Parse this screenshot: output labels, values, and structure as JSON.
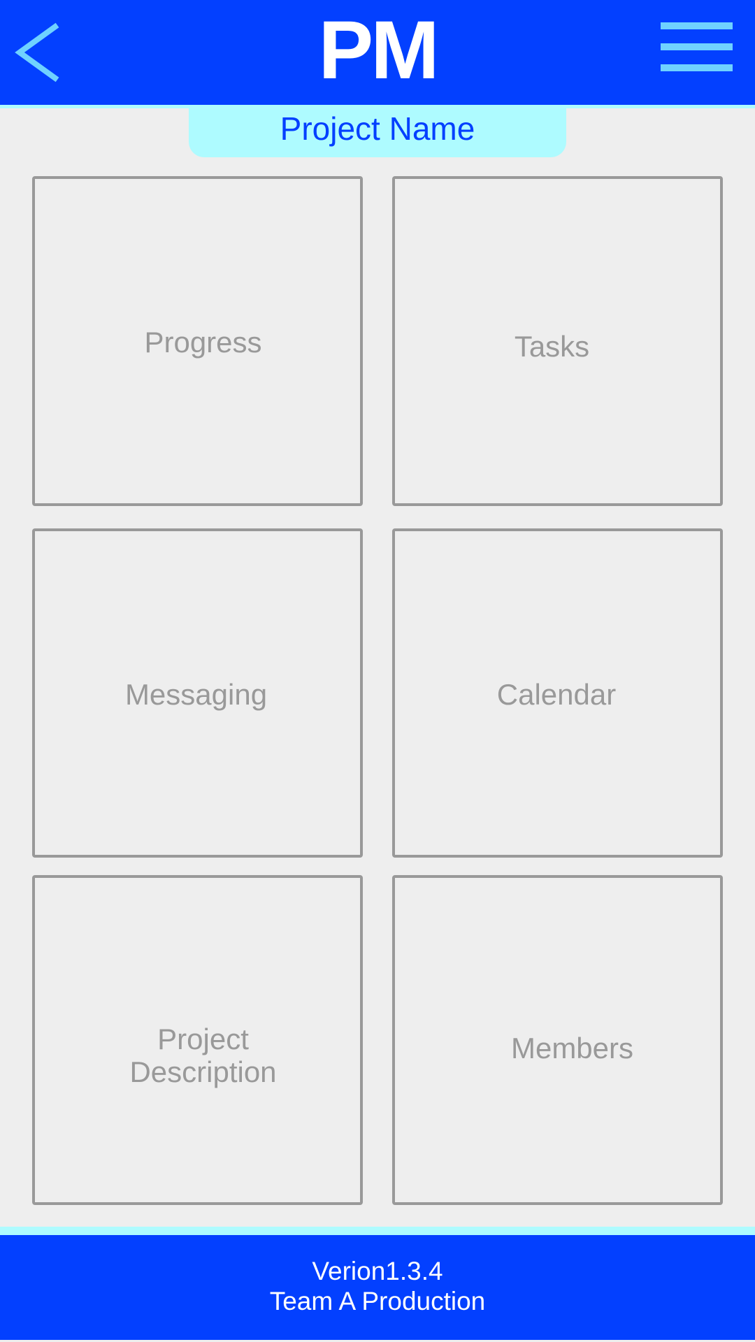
{
  "header": {
    "title": "PM",
    "back_icon": "chevron-left-icon",
    "menu_icon": "hamburger-menu-icon"
  },
  "project": {
    "name": "Project Name"
  },
  "tiles": [
    {
      "label": "Progress"
    },
    {
      "label": "Tasks"
    },
    {
      "label": "Messaging"
    },
    {
      "label": "Calendar"
    },
    {
      "label_line1": "Project",
      "label_line2": "Description"
    },
    {
      "label": "Members"
    }
  ],
  "footer": {
    "version": "Verion1.3.4",
    "team": "Team A Production"
  },
  "colors": {
    "primary_blue": "#0340ff",
    "accent_cyan": "#aefbff",
    "icon_light_blue": "#6fd2ff",
    "tile_gray": "#999999",
    "background": "#eeeeee"
  }
}
